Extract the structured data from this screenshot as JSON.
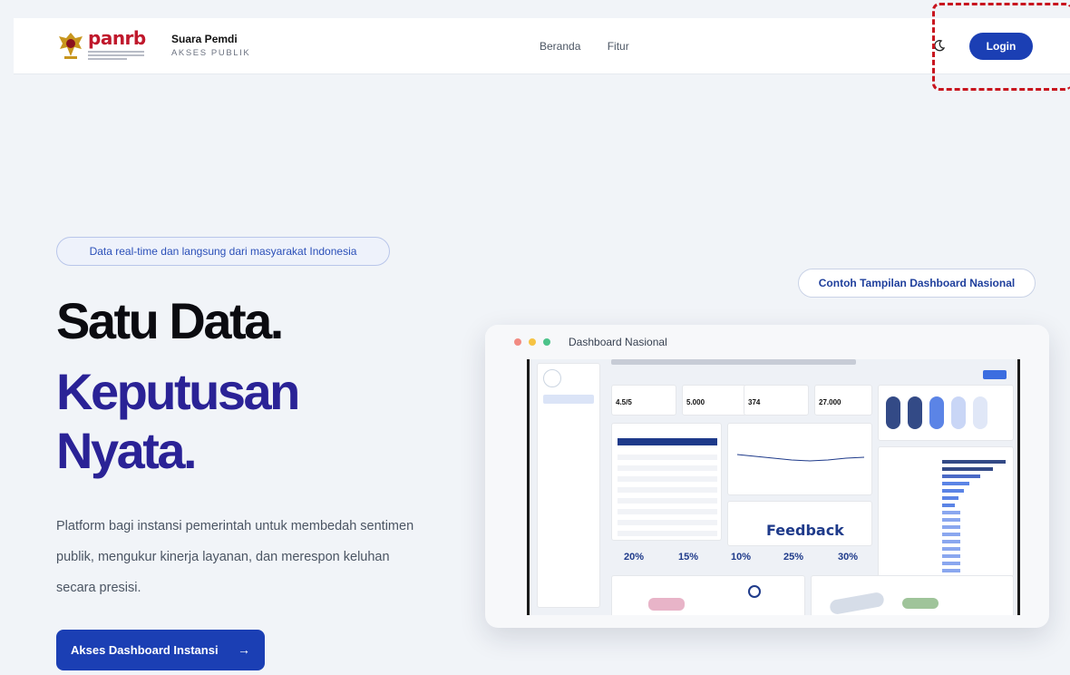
{
  "header": {
    "logo_word": "panrb",
    "brand_name": "Suara Pemdi",
    "brand_sub": "AKSES PUBLIK",
    "nav": [
      "Beranda",
      "Fitur"
    ],
    "login_label": "Login"
  },
  "hero": {
    "badge": "Data real-time dan langsung dari masyarakat Indonesia",
    "title_line1": "Satu Data.",
    "title_line2": "Keputusan",
    "title_line3": "Nyata.",
    "description": "Platform bagi instansi pemerintah untuk membedah sentimen publik, mengukur kinerja layanan, dan merespon keluhan secara presisi.",
    "cta_label": "Akses Dashboard Instansi",
    "cta_arrow": "→"
  },
  "preview": {
    "pill_label": "Contoh Tampilan Dashboard Nasional",
    "window_title": "Dashboard Nasional",
    "kpis": [
      "4.5/5",
      "5.000",
      "374",
      "27.000"
    ],
    "percents": [
      "20%",
      "15%",
      "10%",
      "25%",
      "30%"
    ],
    "wordcloud_word": "Feedback"
  },
  "colors": {
    "brand_blue": "#1b3fb4",
    "heading_purple": "#2a2296",
    "logo_red": "#c0182c",
    "highlight_red": "#c8141e"
  }
}
